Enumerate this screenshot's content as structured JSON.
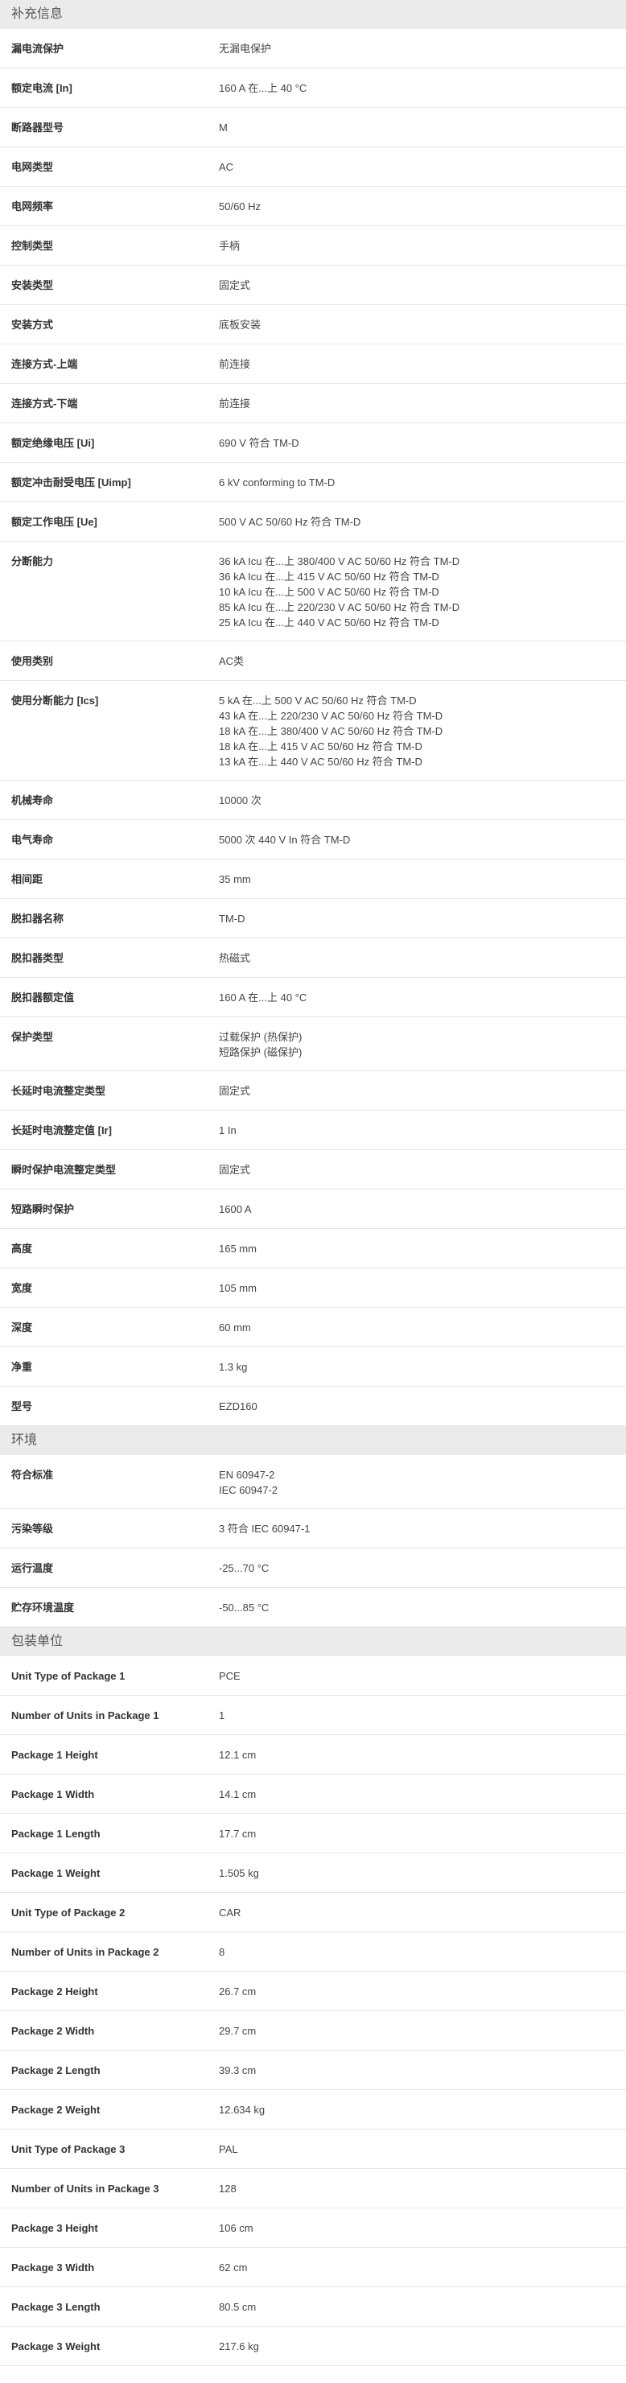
{
  "sections": [
    {
      "title": "补充信息",
      "rows": [
        {
          "label": "漏电流保护",
          "values": [
            "无漏电保护"
          ]
        },
        {
          "label": "额定电流 [In]",
          "values": [
            "160 A 在...上 40 °C"
          ]
        },
        {
          "label": "断路器型号",
          "values": [
            "M"
          ]
        },
        {
          "label": "电网类型",
          "values": [
            "AC"
          ]
        },
        {
          "label": "电网频率",
          "values": [
            "50/60 Hz"
          ]
        },
        {
          "label": "控制类型",
          "values": [
            "手柄"
          ]
        },
        {
          "label": "安装类型",
          "values": [
            "固定式"
          ]
        },
        {
          "label": "安装方式",
          "values": [
            "底板安装"
          ]
        },
        {
          "label": "连接方式-上端",
          "values": [
            "前连接"
          ]
        },
        {
          "label": "连接方式-下端",
          "values": [
            "前连接"
          ]
        },
        {
          "label": "额定绝缘电压 [Ui]",
          "values": [
            "690 V 符合 TM-D"
          ]
        },
        {
          "label": "额定冲击耐受电压 [Uimp]",
          "values": [
            "6 kV conforming to TM-D"
          ]
        },
        {
          "label": "额定工作电压 [Ue]",
          "values": [
            "500 V AC 50/60 Hz 符合 TM-D"
          ]
        },
        {
          "label": "分断能力",
          "values": [
            "36 kA Icu 在...上 380/400 V AC 50/60 Hz 符合 TM-D",
            "36 kA Icu 在...上 415 V AC 50/60 Hz 符合 TM-D",
            "10 kA Icu 在...上 500 V AC 50/60 Hz 符合 TM-D",
            "85 kA Icu 在...上 220/230 V AC 50/60 Hz 符合 TM-D",
            "25 kA Icu 在...上 440 V AC 50/60 Hz 符合 TM-D"
          ]
        },
        {
          "label": "使用类别",
          "values": [
            "AC类"
          ]
        },
        {
          "label": "使用分断能力 [Ics]",
          "values": [
            "5 kA 在...上 500 V AC 50/60 Hz 符合 TM-D",
            "43 kA 在...上 220/230 V AC 50/60 Hz 符合 TM-D",
            "18 kA 在...上 380/400 V AC 50/60 Hz 符合 TM-D",
            "18 kA 在...上 415 V AC 50/60 Hz 符合 TM-D",
            "13 kA 在...上 440 V AC 50/60 Hz 符合 TM-D"
          ]
        },
        {
          "label": "机械寿命",
          "values": [
            "10000 次"
          ]
        },
        {
          "label": "电气寿命",
          "values": [
            "5000 次 440 V In 符合 TM-D"
          ]
        },
        {
          "label": "相间距",
          "values": [
            "35 mm"
          ]
        },
        {
          "label": "脱扣器名称",
          "values": [
            "TM-D"
          ]
        },
        {
          "label": "脱扣器类型",
          "values": [
            "热磁式"
          ]
        },
        {
          "label": "脱扣器额定值",
          "values": [
            "160 A 在...上 40 °C"
          ]
        },
        {
          "label": "保护类型",
          "values": [
            "过载保护 (热保护)",
            "短路保护 (磁保护)"
          ]
        },
        {
          "label": "长延时电流整定类型",
          "values": [
            "固定式"
          ]
        },
        {
          "label": "长延时电流整定值 [Ir]",
          "values": [
            "1 In"
          ]
        },
        {
          "label": "瞬时保护电流整定类型",
          "values": [
            "固定式"
          ]
        },
        {
          "label": "短路瞬时保护",
          "values": [
            "1600 A"
          ]
        },
        {
          "label": "高度",
          "values": [
            "165 mm"
          ]
        },
        {
          "label": "宽度",
          "values": [
            "105 mm"
          ]
        },
        {
          "label": "深度",
          "values": [
            "60 mm"
          ]
        },
        {
          "label": "净重",
          "values": [
            "1.3 kg"
          ]
        },
        {
          "label": "型号",
          "values": [
            "EZD160"
          ]
        }
      ]
    },
    {
      "title": "环境",
      "rows": [
        {
          "label": "符合标准",
          "values": [
            "EN 60947-2",
            "IEC 60947-2"
          ]
        },
        {
          "label": "污染等级",
          "values": [
            "3 符合 IEC 60947-1"
          ]
        },
        {
          "label": "运行温度",
          "values": [
            "-25...70 °C"
          ]
        },
        {
          "label": "贮存环境温度",
          "values": [
            "-50...85 °C"
          ]
        }
      ]
    },
    {
      "title": "包装单位",
      "rows": [
        {
          "label": "Unit Type of Package 1",
          "values": [
            "PCE"
          ]
        },
        {
          "label": "Number of Units in Package 1",
          "values": [
            "1"
          ]
        },
        {
          "label": "Package 1 Height",
          "values": [
            "12.1 cm"
          ]
        },
        {
          "label": "Package 1 Width",
          "values": [
            "14.1 cm"
          ]
        },
        {
          "label": "Package 1 Length",
          "values": [
            "17.7 cm"
          ]
        },
        {
          "label": "Package 1 Weight",
          "values": [
            "1.505 kg"
          ]
        },
        {
          "label": "Unit Type of Package 2",
          "values": [
            "CAR"
          ]
        },
        {
          "label": "Number of Units in Package 2",
          "values": [
            "8"
          ]
        },
        {
          "label": "Package 2 Height",
          "values": [
            "26.7 cm"
          ]
        },
        {
          "label": "Package 2 Width",
          "values": [
            "29.7 cm"
          ]
        },
        {
          "label": "Package 2 Length",
          "values": [
            "39.3 cm"
          ]
        },
        {
          "label": "Package 2 Weight",
          "values": [
            "12.634 kg"
          ]
        },
        {
          "label": "Unit Type of Package 3",
          "values": [
            "PAL"
          ]
        },
        {
          "label": "Number of Units in Package 3",
          "values": [
            "128"
          ]
        },
        {
          "label": "Package 3 Height",
          "values": [
            "106 cm"
          ]
        },
        {
          "label": "Package 3 Width",
          "values": [
            "62 cm"
          ]
        },
        {
          "label": "Package 3 Length",
          "values": [
            "80.5 cm"
          ]
        },
        {
          "label": "Package 3 Weight",
          "values": [
            "217.6 kg"
          ]
        }
      ]
    }
  ]
}
